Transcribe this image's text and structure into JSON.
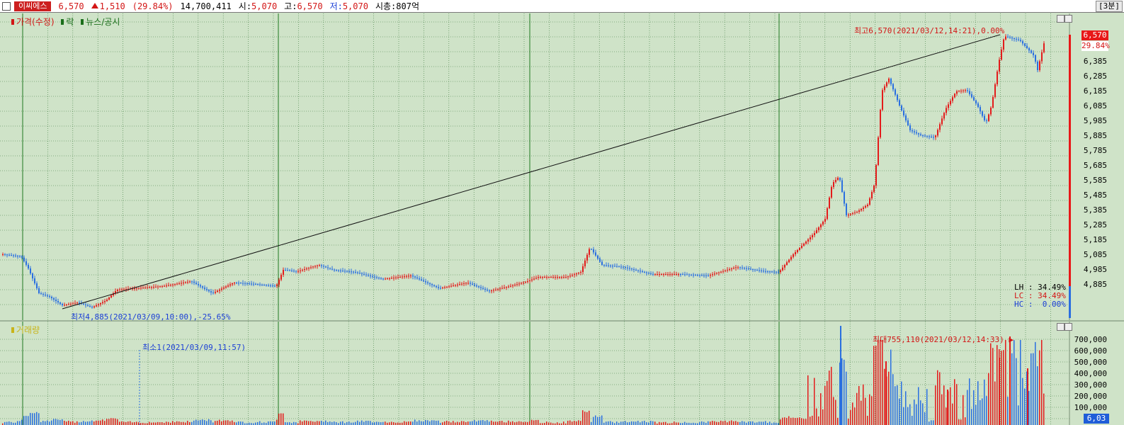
{
  "topbar": {
    "stock_name": "이씨에스",
    "price": "6,570",
    "change": "1,510",
    "change_pct": "(29.84%)",
    "volume": "14,700,411",
    "open_label": "시:",
    "open": "5,070",
    "high_label": "고:",
    "high": "6,570",
    "low_label": "저:",
    "low": "5,070",
    "mktcap_label": "시총:",
    "mktcap": "807억",
    "timeframe": "[3분]"
  },
  "price_pane": {
    "legend": [
      "가격(수정)",
      "락",
      "뉴스/공시"
    ],
    "high_annotation": "최고6,570(2021/03/12,14:21),0.00%",
    "low_annotation": "최저4,885(2021/03/09,10:00),-25.65%",
    "current_price": "6,570",
    "current_pct": "29.84%",
    "stats": {
      "lh": "LH : 34.49%",
      "lc": "LC : 34.49%",
      "hc": "HC :  0.00%"
    },
    "axis_ticks": [
      "6,385",
      "6,285",
      "6,185",
      "6,085",
      "5,985",
      "5,885",
      "5,785",
      "5,685",
      "5,585",
      "5,485",
      "5,385",
      "5,285",
      "5,185",
      "5,085",
      "4,985",
      "4,885"
    ]
  },
  "volume_pane": {
    "legend": "거래량",
    "max_annotation": "최대755,110(2021/03/12,14:33)",
    "min_annotation": "최소1(2021/03/09,11:57)",
    "axis_ticks": [
      "700,000",
      "600,000",
      "500,000",
      "400,000",
      "300,000",
      "200,000",
      "100,000"
    ],
    "current_volume": "6,03"
  },
  "colors": {
    "background": "#cfe3c8",
    "up": "#e31b1b",
    "down": "#2a6fe0",
    "grid": "#3c7a3c",
    "day_separator": "#1f7a1f"
  }
}
